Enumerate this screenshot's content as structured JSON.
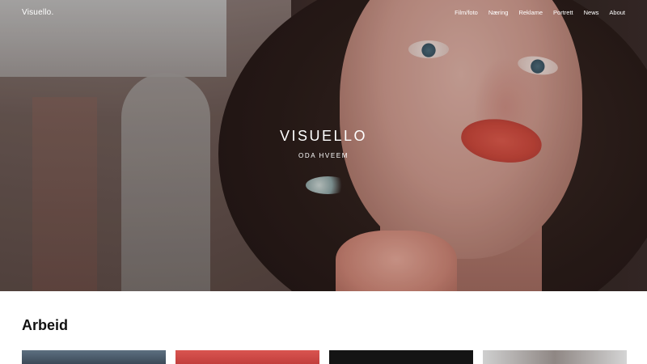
{
  "header": {
    "logo": "Visuello.",
    "nav": [
      "Film/foto",
      "Næring",
      "Reklame",
      "Portrett",
      "News",
      "About"
    ]
  },
  "hero": {
    "title": "VISUELLO",
    "subtitle": "ODA HVEEM"
  },
  "section": {
    "title": "Arbeid"
  },
  "colors": {
    "text_on_hero": "#ffffff",
    "body_text": "#111111",
    "card_red": "#d95450"
  }
}
